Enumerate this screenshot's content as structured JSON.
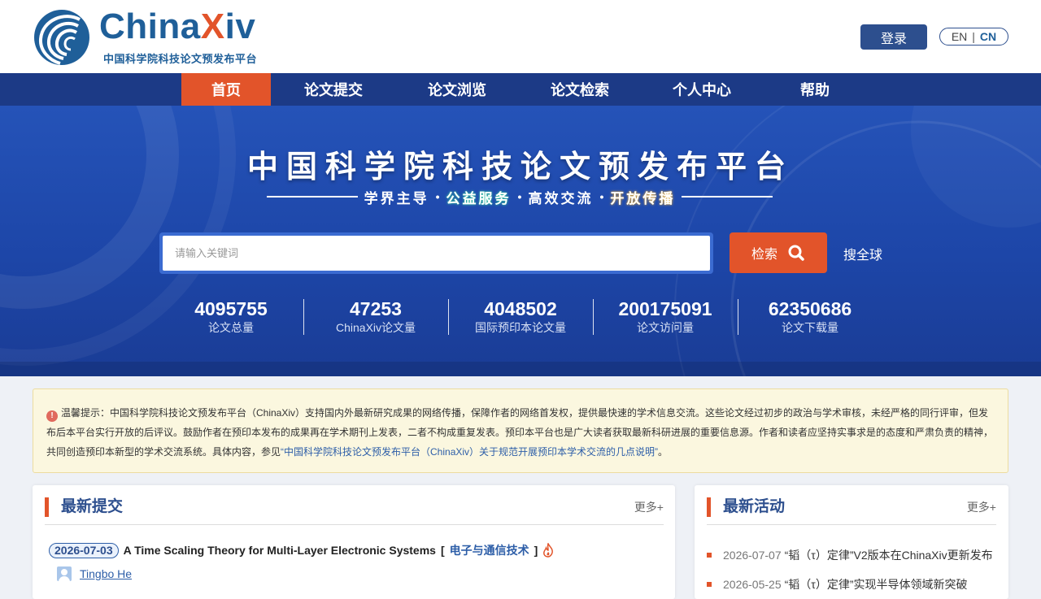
{
  "header": {
    "logo_prefix": "China",
    "logo_x": "X",
    "logo_suffix": "iv",
    "logo_subtitle": "中国科学院科技论文预发布平台",
    "login_label": "登录",
    "lang_en": "EN",
    "lang_sep": "|",
    "lang_cn": "CN"
  },
  "nav": {
    "items": [
      {
        "label": "首页",
        "active": true
      },
      {
        "label": "论文提交"
      },
      {
        "label": "论文浏览"
      },
      {
        "label": "论文检索"
      },
      {
        "label": "个人中心"
      },
      {
        "label": "帮助"
      }
    ]
  },
  "banner": {
    "title": "中国科学院科技论文预发布平台",
    "slogan": [
      "学界主导",
      "公益服务",
      "高效交流",
      "开放传播"
    ],
    "slogan_dot": "•",
    "search_placeholder": "请输入关键词",
    "search_button": "检索",
    "global_search": "搜全球"
  },
  "stats": [
    {
      "value": "4095755",
      "label": "论文总量"
    },
    {
      "value": "47253",
      "label": "ChinaXiv论文量"
    },
    {
      "value": "4048502",
      "label": "国际预印本论文量"
    },
    {
      "value": "200175091",
      "label": "论文访问量"
    },
    {
      "value": "62350686",
      "label": "论文下载量"
    }
  ],
  "notice": {
    "icon": "!",
    "text": "温馨提示：中国科学院科技论文预发布平台（ChinaXiv）支持国内外最新研究成果的网络传播，保障作者的网络首发权，提供最快速的学术信息交流。这些论文经过初步的政治与学术审核，未经严格的同行评审，但发布后本平台实行开放的后评议。鼓励作者在预印本发布的成果再在学术期刊上发表，二者不构成重复发表。预印本平台也是广大读者获取最新科研进展的重要信息源。作者和读者应坚持实事求是的态度和严肃负责的精神，共同创造预印本新型的学术交流系统。具体内容，参见",
    "link_text": "“中国科学院科技论文预发布平台（ChinaXiv）关于规范开展预印本学术交流的几点说明”",
    "end": "。"
  },
  "latest_submissions": {
    "title": "最新提交",
    "more": "更多+",
    "items": [
      {
        "date": "2026-07-03",
        "title": "A Time Scaling Theory for Multi-Layer Electronic Systems",
        "bracket_open": "[",
        "category": "电子与通信技术",
        "bracket_close": "]",
        "author": "Tingbo He"
      }
    ]
  },
  "latest_activities": {
    "title": "最新活动",
    "more": "更多+",
    "items": [
      {
        "date": "2026-07-07",
        "text": "“韬（τ）定律”V2版本在ChinaXiv更新发布"
      },
      {
        "date": "2026-05-25",
        "text": "“韬（τ）定律”实现半导体领域新突破"
      }
    ]
  },
  "colors": {
    "brand_blue": "#1f5f99",
    "nav_blue": "#1c3a86",
    "accent_orange": "#e2542a"
  }
}
